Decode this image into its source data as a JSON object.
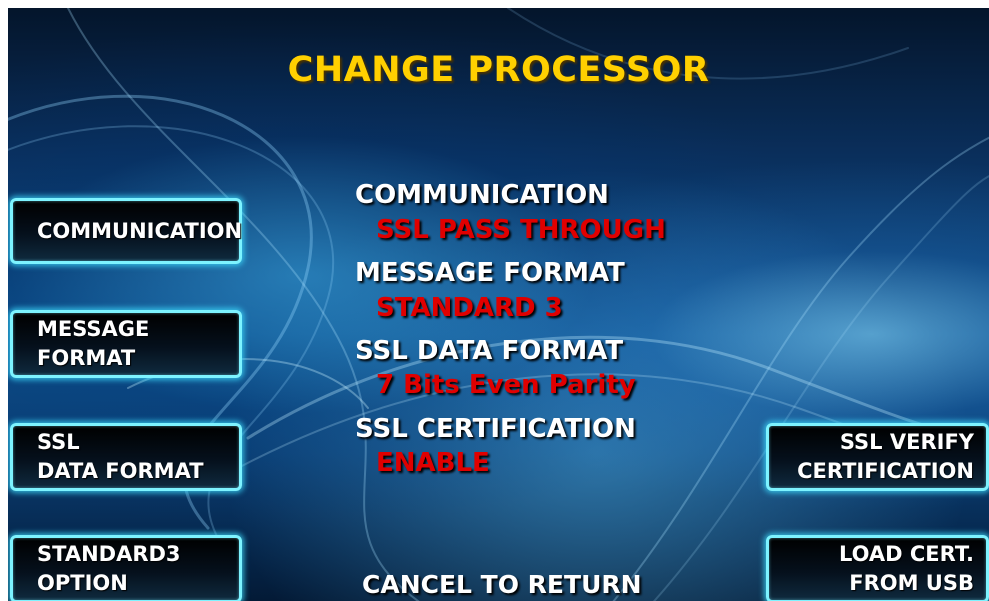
{
  "screen": {
    "title": "CHANGE PROCESSOR",
    "footer": "CANCEL TO RETURN"
  },
  "left_keys": [
    {
      "lines": [
        "COMMUNICATION"
      ]
    },
    {
      "lines": [
        "MESSAGE",
        "FORMAT"
      ]
    },
    {
      "lines": [
        "SSL",
        "DATA FORMAT"
      ]
    },
    {
      "lines": [
        "STANDARD3",
        "OPTION"
      ]
    }
  ],
  "right_keys": [
    {
      "lines": [
        "SSL VERIFY",
        "CERTIFICATION"
      ]
    },
    {
      "lines": [
        "LOAD CERT.",
        "FROM USB"
      ]
    }
  ],
  "settings": [
    {
      "label": "COMMUNICATION",
      "value": "SSL PASS THROUGH"
    },
    {
      "label": "MESSAGE FORMAT",
      "value": "STANDARD 3"
    },
    {
      "label": "SSL DATA FORMAT",
      "value": "7 Bits Even Parity"
    },
    {
      "label": "SSL CERTIFICATION",
      "value": "ENABLE"
    }
  ],
  "colors": {
    "title": "#ffd000",
    "value": "#e00000",
    "key_border": "#7df3ff",
    "background": "#0e4f8a"
  }
}
